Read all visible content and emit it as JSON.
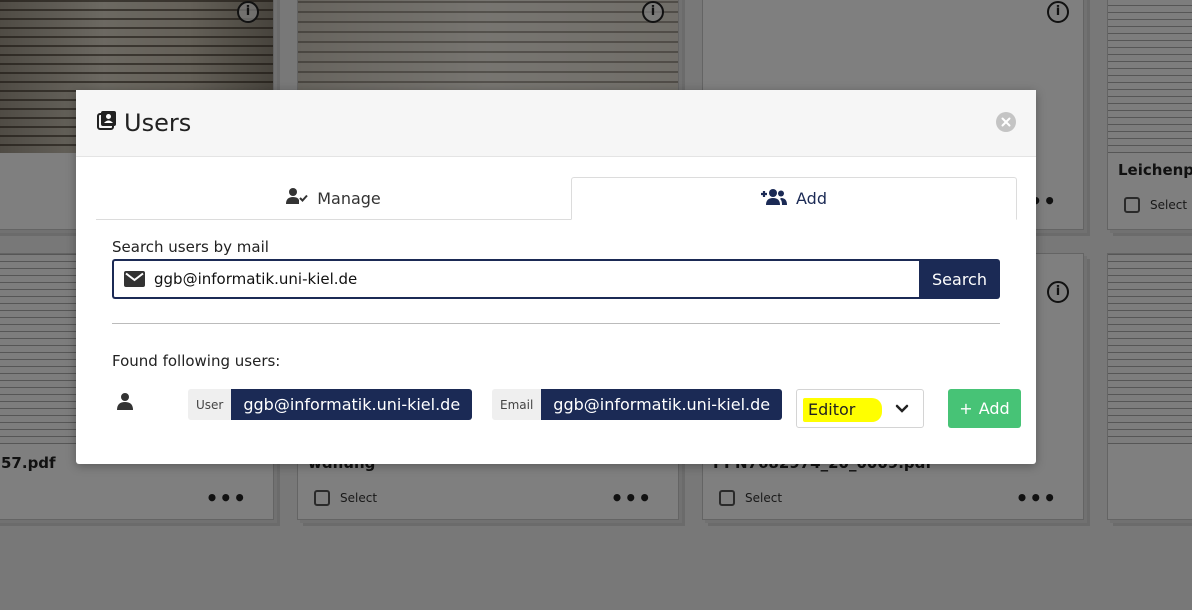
{
  "background": {
    "cards": [
      {
        "title": "",
        "select_label": ""
      },
      {
        "title": "",
        "select_label": ""
      },
      {
        "title": "",
        "select_label": ""
      },
      {
        "title": "Leichenpre",
        "select_label": "Select"
      },
      {
        "title": "57.pdf",
        "select_label": ""
      },
      {
        "title": "wdnung",
        "select_label": "Select"
      },
      {
        "title": "PPN7682974_20_0009.pdf",
        "select_label": "Select"
      },
      {
        "title": "",
        "select_label": ""
      }
    ],
    "info_glyph": "i",
    "more_glyph": "•••"
  },
  "modal": {
    "title": "Users",
    "icon": "users-book-icon",
    "tabs": [
      {
        "label": "Manage",
        "icon": "user-check-icon",
        "active": false
      },
      {
        "label": "Add",
        "icon": "user-plus-icon",
        "active": true
      }
    ],
    "search": {
      "label": "Search users by mail",
      "value": "ggb@informatik.uni-kiel.de",
      "button_label": "Search"
    },
    "results": {
      "heading": "Found following users:",
      "users": [
        {
          "user_key": "User",
          "user_value": "ggb@informatik.uni-kiel.de",
          "email_key": "Email",
          "email_value": "ggb@informatik.uni-kiel.de",
          "role": "Editor",
          "add_label": "Add"
        }
      ]
    }
  },
  "colors": {
    "navy": "#1b2a55",
    "add_green": "#47c376",
    "highlight": "#ffff00"
  }
}
